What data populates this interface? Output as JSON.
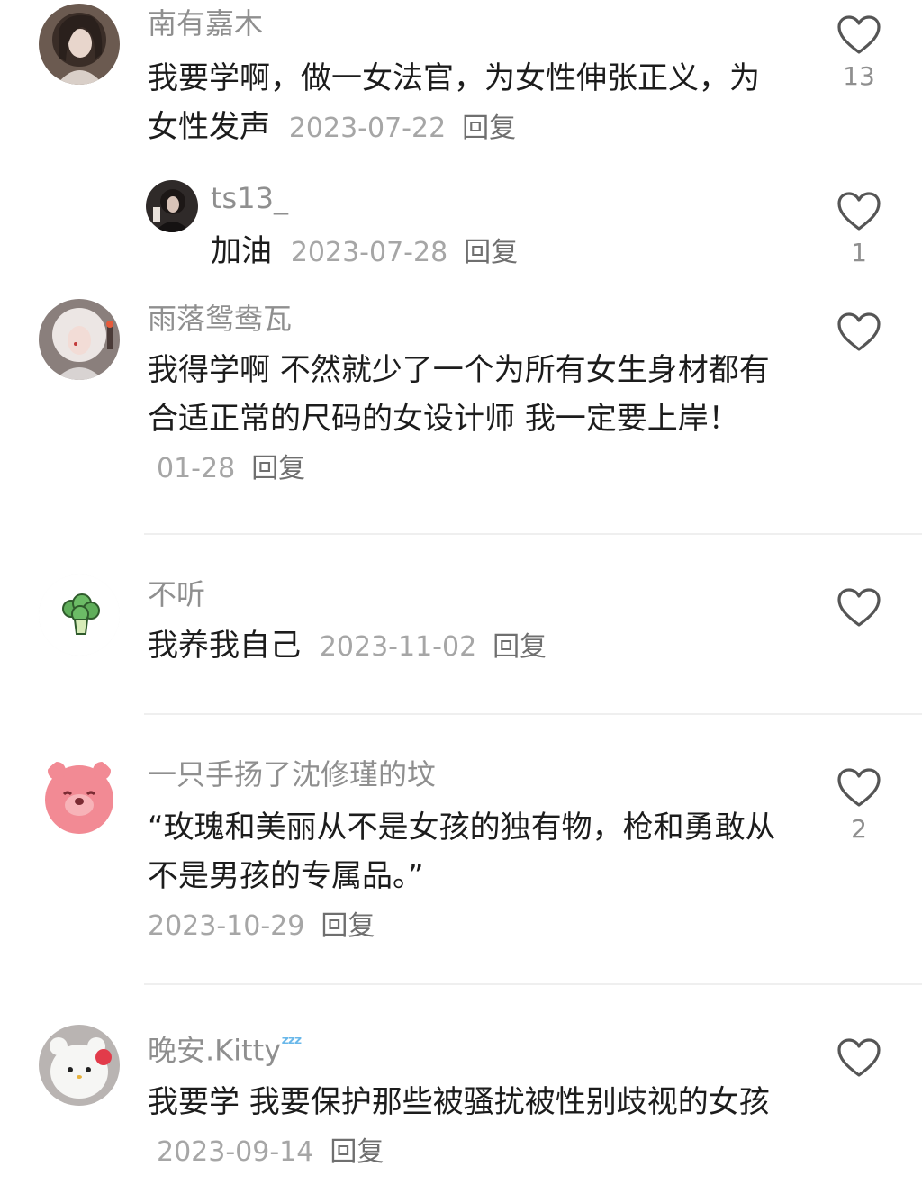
{
  "comments": [
    {
      "username": "南有嘉木",
      "text": "我要学啊，做一女法官，为女性伸张正义，为女性发声",
      "date": "2023-07-22",
      "reply_label": "回复",
      "likes": "13",
      "avatar_icon": "user-avatar-girl-photo",
      "replies": [
        {
          "username": "ts13_",
          "text": "加油",
          "date": "2023-07-28",
          "reply_label": "回复",
          "likes": "1",
          "avatar_icon": "user-avatar-dark-photo"
        }
      ]
    },
    {
      "username": "雨落鸳鸯瓦",
      "text": "我得学啊 不然就少了一个为所有女生身材都有合适正常的尺码的女设计师 我一定要上岸！",
      "date": "01-28",
      "reply_label": "回复",
      "likes": "",
      "avatar_icon": "user-avatar-white-hair-girl"
    },
    {
      "username": "不听",
      "text": "我养我自己",
      "date": "2023-11-02",
      "reply_label": "回复",
      "likes": "",
      "avatar_icon": "broccoli-icon"
    },
    {
      "username": "一只手扬了沈修瑾的坟",
      "text": "“玫瑰和美丽从不是女孩的独有物，枪和勇敢从不是男孩的专属品。”",
      "date": "2023-10-29",
      "reply_label": "回复",
      "likes": "2",
      "avatar_icon": "pink-bear-avatar"
    },
    {
      "username": "晚安.Kitty",
      "username_badge": "zzz",
      "text": "我要学 我要保护那些被骚扰被性别歧视的女孩",
      "date": "2023-09-14",
      "reply_label": "回复",
      "likes": "",
      "avatar_icon": "white-kitty-avatar"
    }
  ],
  "colors": {
    "username": "#8f8f8f",
    "text": "#1c1c1c",
    "date": "#a6a6a6",
    "divider": "#efefef",
    "heart_outline": "#555555"
  }
}
